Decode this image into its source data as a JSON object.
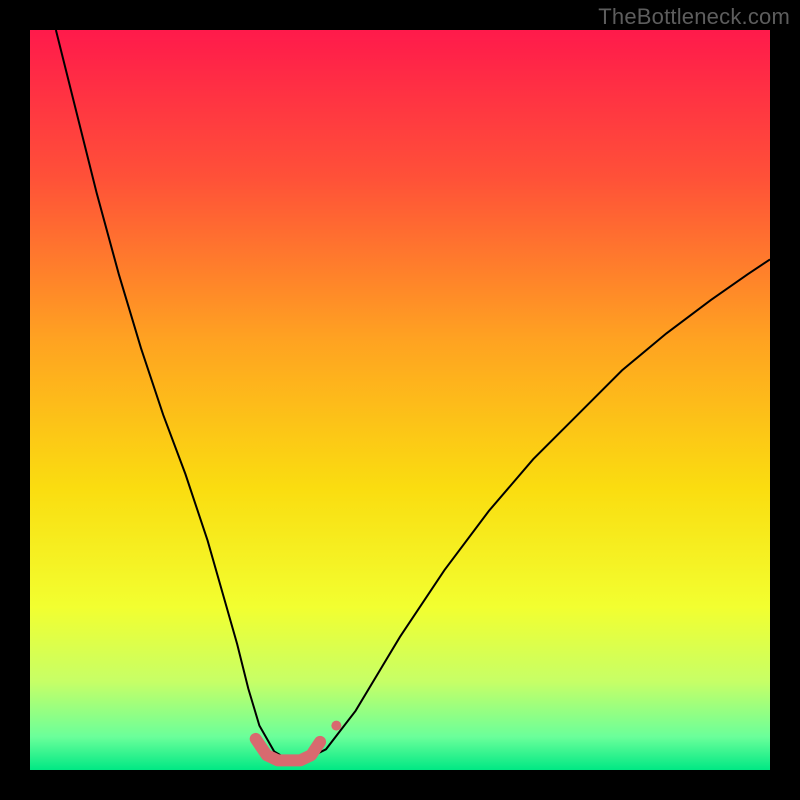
{
  "watermark": "TheBottleneck.com",
  "chart_data": {
    "type": "line",
    "title": "",
    "xlabel": "",
    "ylabel": "",
    "xlim": [
      0,
      100
    ],
    "ylim": [
      0,
      100
    ],
    "grid": false,
    "legend": false,
    "background_gradient": {
      "stops": [
        {
          "offset": 0.0,
          "color": "#ff1a4b"
        },
        {
          "offset": 0.2,
          "color": "#ff5138"
        },
        {
          "offset": 0.42,
          "color": "#ffa321"
        },
        {
          "offset": 0.62,
          "color": "#fadd10"
        },
        {
          "offset": 0.78,
          "color": "#f2ff30"
        },
        {
          "offset": 0.88,
          "color": "#c7ff66"
        },
        {
          "offset": 0.955,
          "color": "#6bff9a"
        },
        {
          "offset": 1.0,
          "color": "#00e884"
        }
      ]
    },
    "series": [
      {
        "name": "bottleneck-curve",
        "stroke": "#000000",
        "stroke_width": 2,
        "x": [
          3.5,
          6,
          9,
          12,
          15,
          18,
          21,
          24,
          26,
          28,
          29.5,
          31,
          33,
          35,
          37,
          40,
          44,
          50,
          56,
          62,
          68,
          74,
          80,
          86,
          92,
          97,
          100
        ],
        "y": [
          100,
          90,
          78,
          67,
          57,
          48,
          40,
          31,
          24,
          17,
          11,
          6,
          2.5,
          1.3,
          1.3,
          2.8,
          8,
          18,
          27,
          35,
          42,
          48,
          54,
          59,
          63.5,
          67,
          69
        ]
      },
      {
        "name": "highlight-segment",
        "stroke": "#d86a6f",
        "stroke_width": 12,
        "linecap": "round",
        "x": [
          30.5,
          32,
          33.5,
          35,
          36.5,
          38,
          39.2
        ],
        "y": [
          4.2,
          2.0,
          1.3,
          1.3,
          1.3,
          2.0,
          3.8
        ]
      }
    ],
    "markers": [
      {
        "name": "highlight-dot",
        "x": 41.4,
        "y": 6.0,
        "r": 5,
        "fill": "#d86a6f"
      }
    ]
  }
}
